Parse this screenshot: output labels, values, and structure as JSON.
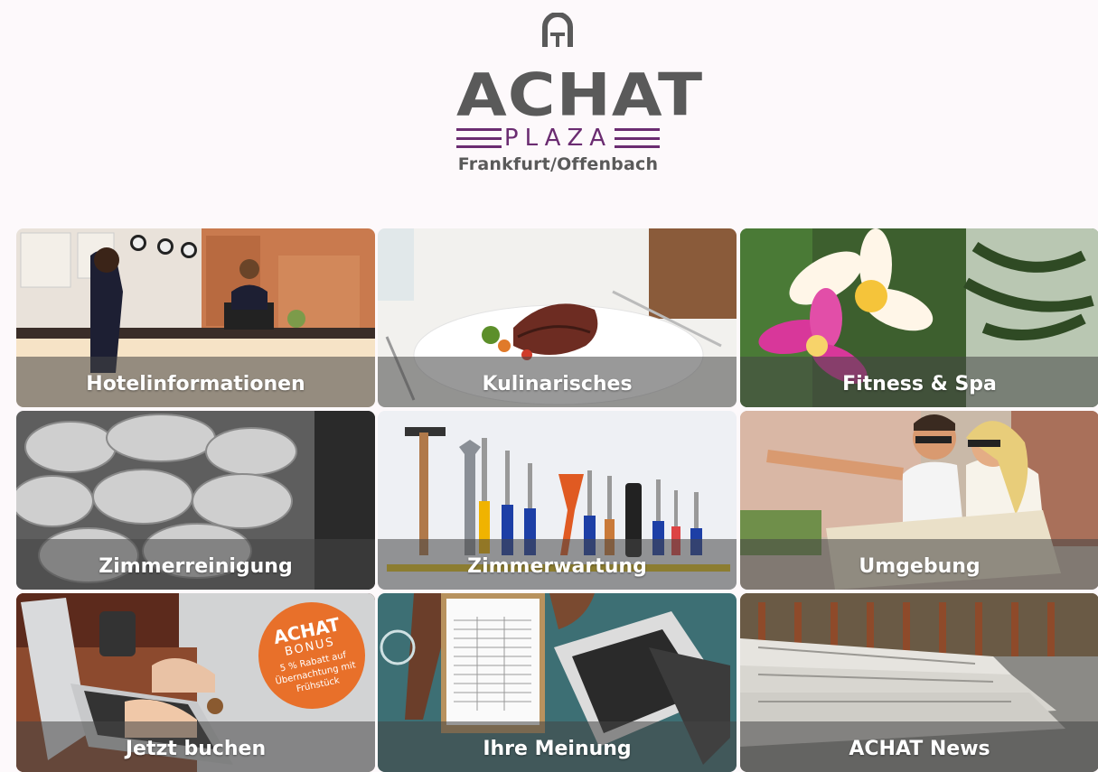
{
  "header": {
    "brand": "ACHAT",
    "sub_brand": "PLAZA",
    "location": "Frankfurt/Offenbach",
    "brand_color": "#5a5a5a",
    "accent_color": "#6b2c71"
  },
  "tiles": [
    {
      "label": "Hotelinformationen",
      "icon": "hotel-reception-photo"
    },
    {
      "label": "Kulinarisches",
      "icon": "dish-photo"
    },
    {
      "label": "Fitness & Spa",
      "icon": "frangipani-flower-photo"
    },
    {
      "label": "Zimmerreinigung",
      "icon": "towels-photo"
    },
    {
      "label": "Zimmerwartung",
      "icon": "tools-photo"
    },
    {
      "label": "Umgebung",
      "icon": "couple-with-map-photo"
    },
    {
      "label": "Jetzt buchen",
      "icon": "laptop-booking-photo"
    },
    {
      "label": "Ihre Meinung",
      "icon": "feedback-form-photo"
    },
    {
      "label": "ACHAT News",
      "icon": "newspapers-photo"
    }
  ],
  "bonus_badge": {
    "brand": "ACHAT",
    "title": "BONUS",
    "line1": "5 % Rabatt auf",
    "line2": "Übernachtung mit",
    "line3": "Frühstück",
    "color": "#e8702a"
  }
}
